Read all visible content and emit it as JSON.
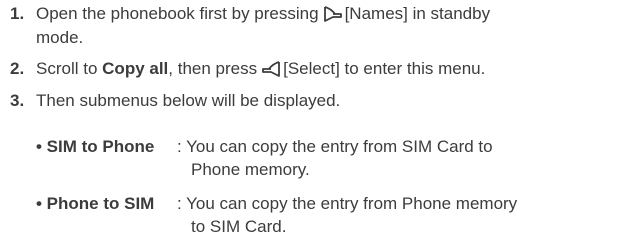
{
  "steps": [
    {
      "number": "1.",
      "line1_before": "Open the phonebook first by pressing",
      "icon1": "left-soft-key-icon",
      "line1_after": "[Names] in standby",
      "line2": "mode."
    },
    {
      "number": "2.",
      "before": "Scroll to",
      "bold": "Copy all",
      "middle": ", then press",
      "icon": "right-soft-key-icon",
      "after": "[Select] to enter this menu."
    },
    {
      "number": "3.",
      "text": "Then submenus below will be displayed."
    }
  ],
  "submenus": [
    {
      "term": "• SIM to Phone",
      "desc_line1": ": You can copy the entry from SIM Card to",
      "desc_line2": "Phone memory."
    },
    {
      "term": "• Phone to SIM",
      "desc_line1": ": You can copy the entry from Phone memory",
      "desc_line2": "to SIM Card."
    }
  ]
}
